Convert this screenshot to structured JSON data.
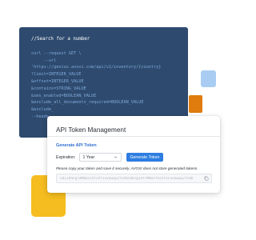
{
  "code": {
    "comment": "//Search for a number",
    "lines": [
      "curl --request GET \\",
      "     --url",
      "'https://genius.avoxi.com/api/v2/inventory/{country}",
      "?limit=INTEGER_VALUE",
      "&offset=INTEGER_VALUE",
      "&contains=STRING_VALUE",
      "&sms_enabled=BOOLEAN_VALUE",
      "&exclude_all_documents_required=BOOLEAN_VALUE",
      "&exclude_",
      "--heade"
    ]
  },
  "card": {
    "title": "API Token Management",
    "section_label": "Generate API Token",
    "expiration_label": "Expiration:",
    "expiration_value": "1 Year",
    "generate_button": "Generate Token",
    "notice": "Please copy your token and save it securely. AVOXI does not store generated tokens.",
    "token_value": "cbiJkhFgldMNvnchfxhfJuvSwwyZfcAbC8kFgIhflMNvnfhcnfxFuvSwwyZfcAb"
  },
  "colors": {
    "code_bg": "#2e4a6e",
    "accent_blue": "#2e7de1",
    "orange": "#e07b0e",
    "yellow": "#f5bd1f",
    "light_blue": "#a9cdf2"
  },
  "icons": {
    "select_chevron": "chevron-down-icon",
    "copy": "copy-icon"
  }
}
